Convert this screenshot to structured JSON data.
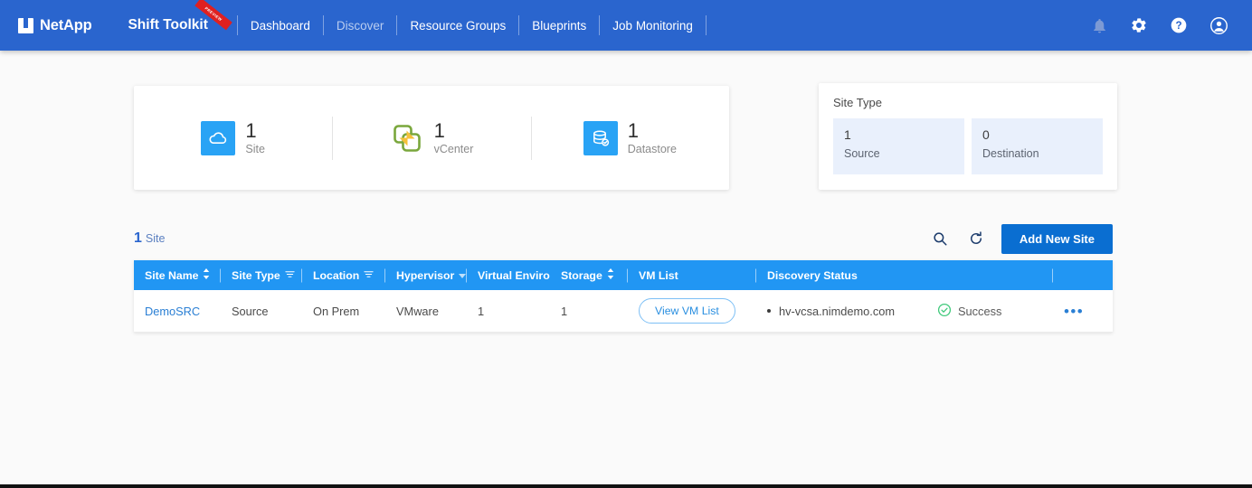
{
  "navbar": {
    "brand": "NetApp",
    "toolkit_title": "Shift Toolkit",
    "preview_badge": "PREVIEW",
    "links": [
      {
        "label": "Dashboard",
        "dim": false
      },
      {
        "label": "Discover",
        "dim": true
      },
      {
        "label": "Resource Groups",
        "dim": false
      },
      {
        "label": "Blueprints",
        "dim": false
      },
      {
        "label": "Job Monitoring",
        "dim": false
      }
    ],
    "icons": [
      {
        "name": "bell-icon",
        "label": "Notifications"
      },
      {
        "name": "gear-icon",
        "label": "Settings"
      },
      {
        "name": "help-icon",
        "label": "Help"
      },
      {
        "name": "account-icon",
        "label": "Account"
      }
    ],
    "bg_color": "#2a65ce"
  },
  "summary": {
    "counts": [
      {
        "value": "1",
        "label": "Site",
        "icon": "cloud-icon"
      },
      {
        "value": "1",
        "label": "vCenter",
        "icon": "vcenter-icon"
      },
      {
        "value": "1",
        "label": "Datastore",
        "icon": "datastore-icon"
      }
    ]
  },
  "site_type_card": {
    "title": "Site Type",
    "boxes": [
      {
        "value": "1",
        "label": "Source"
      },
      {
        "value": "0",
        "label": "Destination"
      }
    ]
  },
  "toolbar": {
    "count": "1",
    "count_label": "Site",
    "search_icon": "search-icon",
    "refresh_icon": "refresh-icon",
    "add_button": "Add New Site"
  },
  "table": {
    "columns": [
      {
        "label": "Site Name",
        "control": "sort"
      },
      {
        "label": "Site Type",
        "control": "filter"
      },
      {
        "label": "Location",
        "control": "filter"
      },
      {
        "label": "Hypervisor",
        "control": "caret"
      },
      {
        "label": "Virtual Environ",
        "control": "none"
      },
      {
        "label": "Storage",
        "control": "sort"
      },
      {
        "label": "VM List",
        "control": "none"
      },
      {
        "label": "Discovery Status",
        "control": "none"
      },
      {
        "label": "",
        "control": "none"
      },
      {
        "label": "",
        "control": "none"
      }
    ],
    "rows": [
      {
        "site_name": "DemoSRC",
        "site_type": "Source",
        "location": "On Prem",
        "hypervisor": "VMware",
        "virtual_environment": "1",
        "storage": "1",
        "vm_list_button": "View VM List",
        "discovery_host": "hv-vcsa.nimdemo.com",
        "status": "Success",
        "status_color": "#3ec97a",
        "actions": "•••"
      }
    ]
  },
  "colors": {
    "nav_blue": "#2a65ce",
    "table_header_blue": "#2196f3",
    "accent_blue": "#0a6ed1",
    "link_blue": "#2a7fd4",
    "success_green": "#3ec97a",
    "page_bg": "#fafafa"
  }
}
